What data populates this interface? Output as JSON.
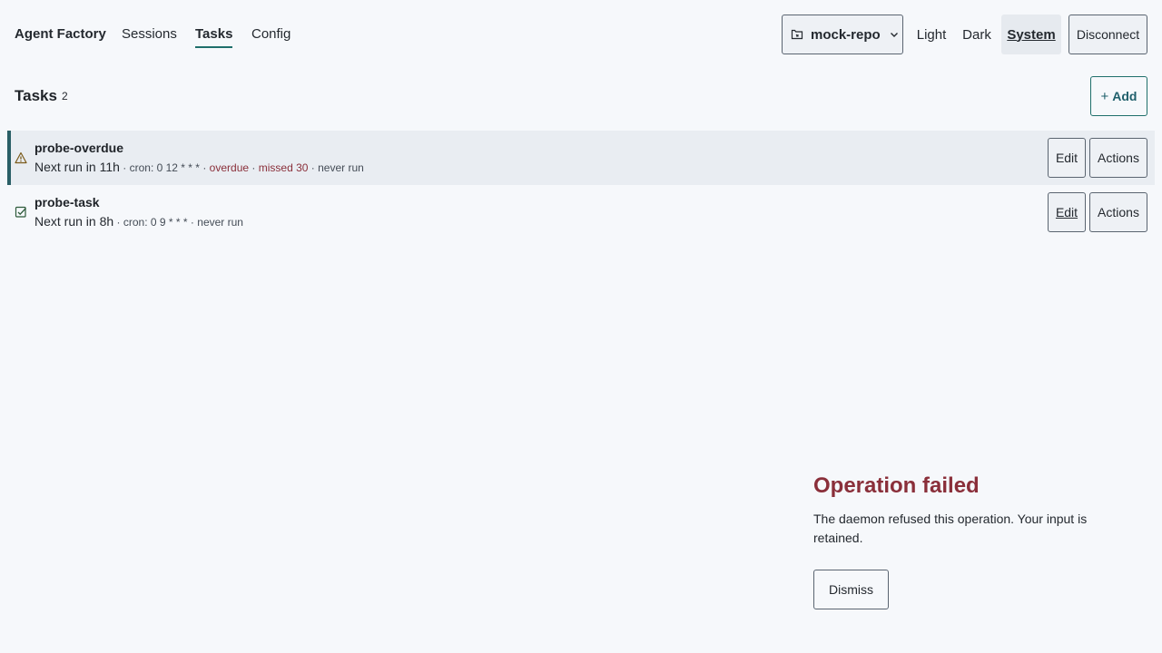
{
  "nav": {
    "brand": "Agent Factory",
    "links": [
      "Sessions",
      "Tasks",
      "Config"
    ],
    "active": "Tasks"
  },
  "repo": {
    "name": "mock-repo",
    "icon": "repo-icon"
  },
  "theme": {
    "options": [
      "Light",
      "Dark",
      "System"
    ],
    "selected": "System"
  },
  "disconnect_label": "Disconnect",
  "tasks_section": {
    "title": "Tasks",
    "count": "2",
    "add_label": "Add",
    "add_icon": "plus-icon"
  },
  "tasks": [
    {
      "name": "probe-overdue",
      "status_icon": "warning-icon",
      "next_run": "Next run in 11h",
      "cron": "cron: 0 12 * * *",
      "overdue": "overdue",
      "missed": "missed 30",
      "last_run": "never run",
      "edit_label": "Edit",
      "actions_label": "Actions"
    },
    {
      "name": "probe-task",
      "status_icon": "check-square-icon",
      "next_run": "Next run in 8h",
      "cron": "cron: 0 9 * * *",
      "last_run": "never run",
      "edit_label": "Edit",
      "actions_label": "Actions"
    }
  ],
  "toast": {
    "title": "Operation failed",
    "message": "The daemon refused this operation. Your input is retained.",
    "dismiss_label": "Dismiss"
  },
  "colors": {
    "accent": "#1f6f6b",
    "error": "#8a2f3a",
    "background": "#f6f8fb"
  }
}
